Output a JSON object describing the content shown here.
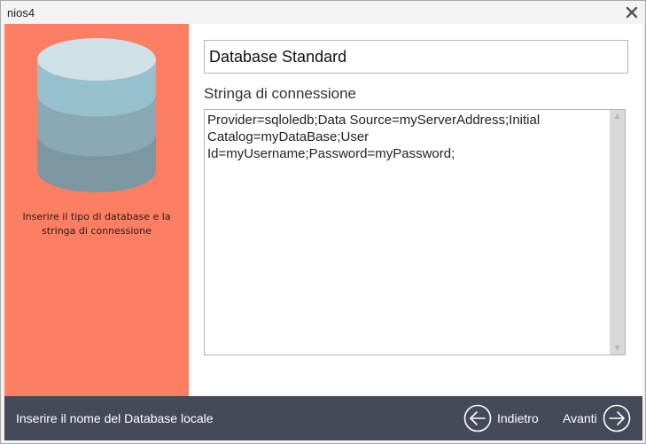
{
  "window": {
    "title": "nios4"
  },
  "sidebar": {
    "caption": "Inserire il tipo di database e la stringa di connessione",
    "icon": "database-icon",
    "background_color": "#fd7f63"
  },
  "main": {
    "database_name_value": "Database Standard",
    "connection_label": "Stringa di connessione",
    "connection_string": "Provider=sqloledb;Data Source=myServerAddress;Initial Catalog=myDataBase;User Id=myUsername;Password=myPassword;"
  },
  "footer": {
    "hint": "Inserire il nome del Database locale",
    "back_label": "Indietro",
    "next_label": "Avanti",
    "background_color": "#464957"
  }
}
